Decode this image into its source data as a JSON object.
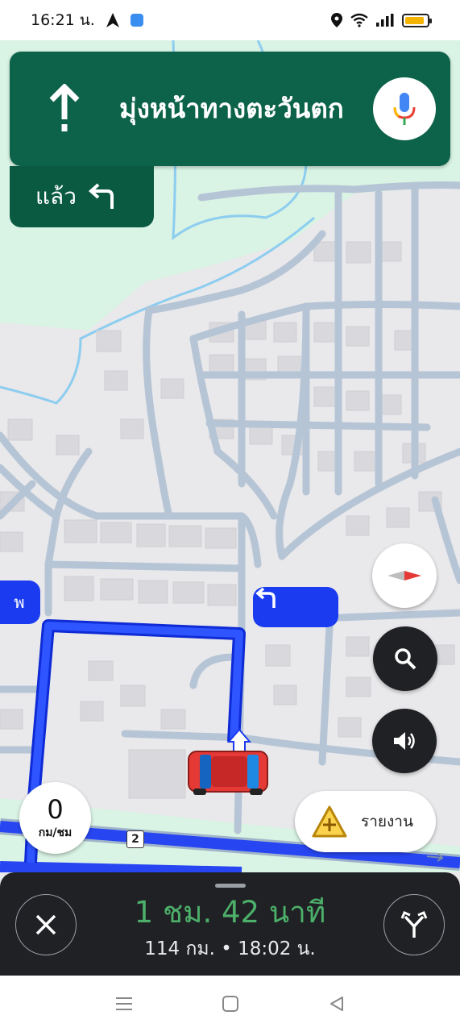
{
  "status_bar": {
    "time": "16:21 น.",
    "battery_level": 0.9,
    "colors": {
      "battery": "#f4b400"
    }
  },
  "navigation": {
    "direction_text": "มุ่งหน้าทางตะวันตก",
    "direction_icon": "straight-arrow-icon",
    "then_label": "แล้ว",
    "then_icon": "turn-left-icon",
    "mic_icon": "microphone-icon",
    "colors": {
      "banner": "#0d6349",
      "then_box": "#0a5a42"
    }
  },
  "map": {
    "left_callout_text": "พ",
    "turn_callout_icon": "turn-left-icon",
    "road_shield": "2",
    "colors": {
      "route": "#1a3bf0",
      "water": "#8ccdf0",
      "green": "#d9f3e4",
      "road": "#b6c5d6"
    }
  },
  "controls": {
    "compass_icon": "compass-icon",
    "search_icon": "search-icon",
    "sound_icon": "volume-icon",
    "speed_value": "0",
    "speed_unit": "กม/ชม",
    "report_label": "รายงาน",
    "report_icon": "report-warning-icon"
  },
  "trip": {
    "eta_duration": "1 ชม. 42 นาที",
    "eta_details": "114 กม. • 18:02 น.",
    "close_icon": "close-icon",
    "route_options_icon": "route-options-icon",
    "colors": {
      "eta": "#4caf6a"
    }
  },
  "system_nav": {
    "recent_icon": "menu-icon",
    "home_icon": "home-icon",
    "back_icon": "back-icon"
  }
}
